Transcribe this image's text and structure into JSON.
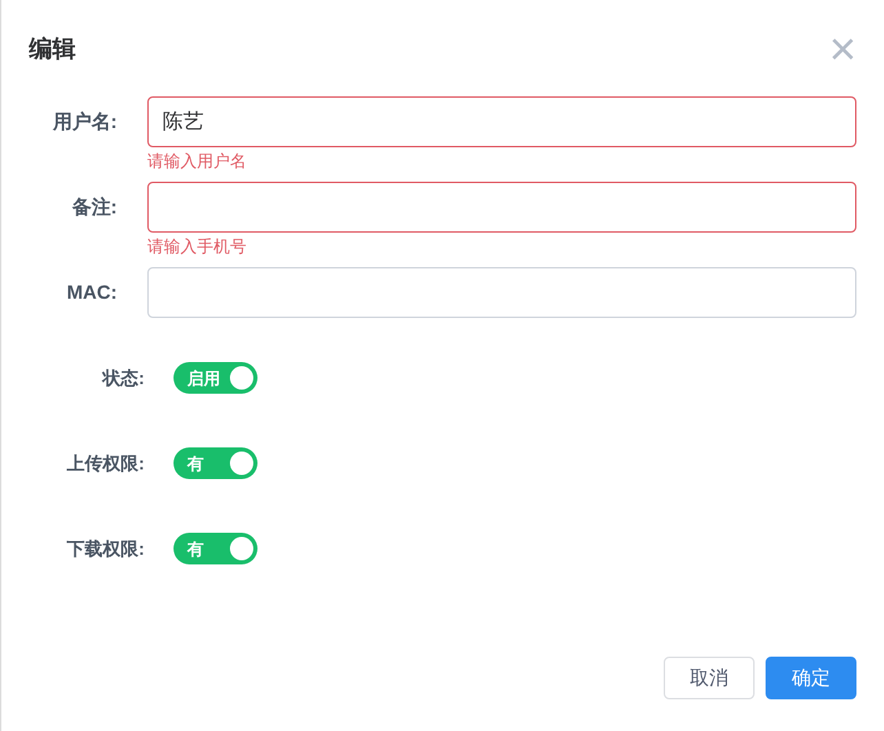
{
  "dialog": {
    "title": "编辑",
    "close": "×"
  },
  "fields": [
    {
      "label": "用户名:",
      "value": "陈艺",
      "error": "请输入用户名"
    },
    {
      "label": "备注:",
      "error": "请输入手机号"
    },
    {
      "label": "MAC:"
    }
  ],
  "switches": [
    {
      "label": "状态:",
      "on": true,
      "text": "启用"
    },
    {
      "label": "上传权限:",
      "on": true,
      "text": "有"
    },
    {
      "label": "下载权限:",
      "on": true,
      "text": "有"
    }
  ],
  "buttons": [
    {
      "label": "取消",
      "kind": "default"
    },
    {
      "label": "确定",
      "kind": "primary"
    }
  ]
}
